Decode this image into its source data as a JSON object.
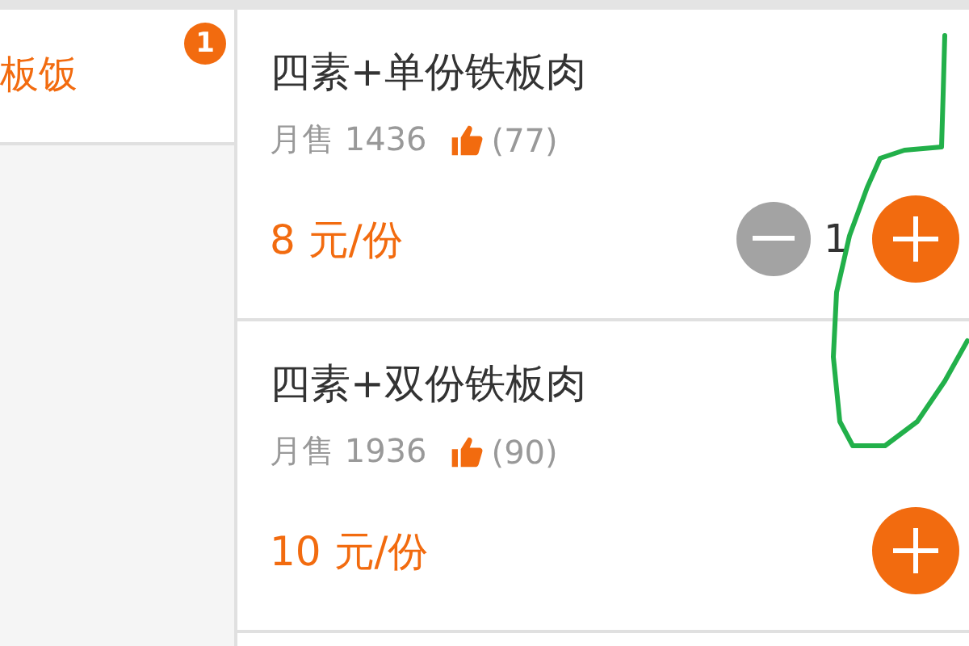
{
  "sidebar": {
    "items": [
      {
        "label": "板饭",
        "selected": true,
        "badge": "1"
      }
    ]
  },
  "dishes": [
    {
      "name": "四素+单份铁板肉",
      "sales_label": "月售 1436",
      "likes": "(77)",
      "price": "8 元/份",
      "quantity": "1"
    },
    {
      "name": "四素+双份铁板肉",
      "sales_label": "月售 1936",
      "likes": "(90)",
      "price": "10 元/份"
    }
  ]
}
